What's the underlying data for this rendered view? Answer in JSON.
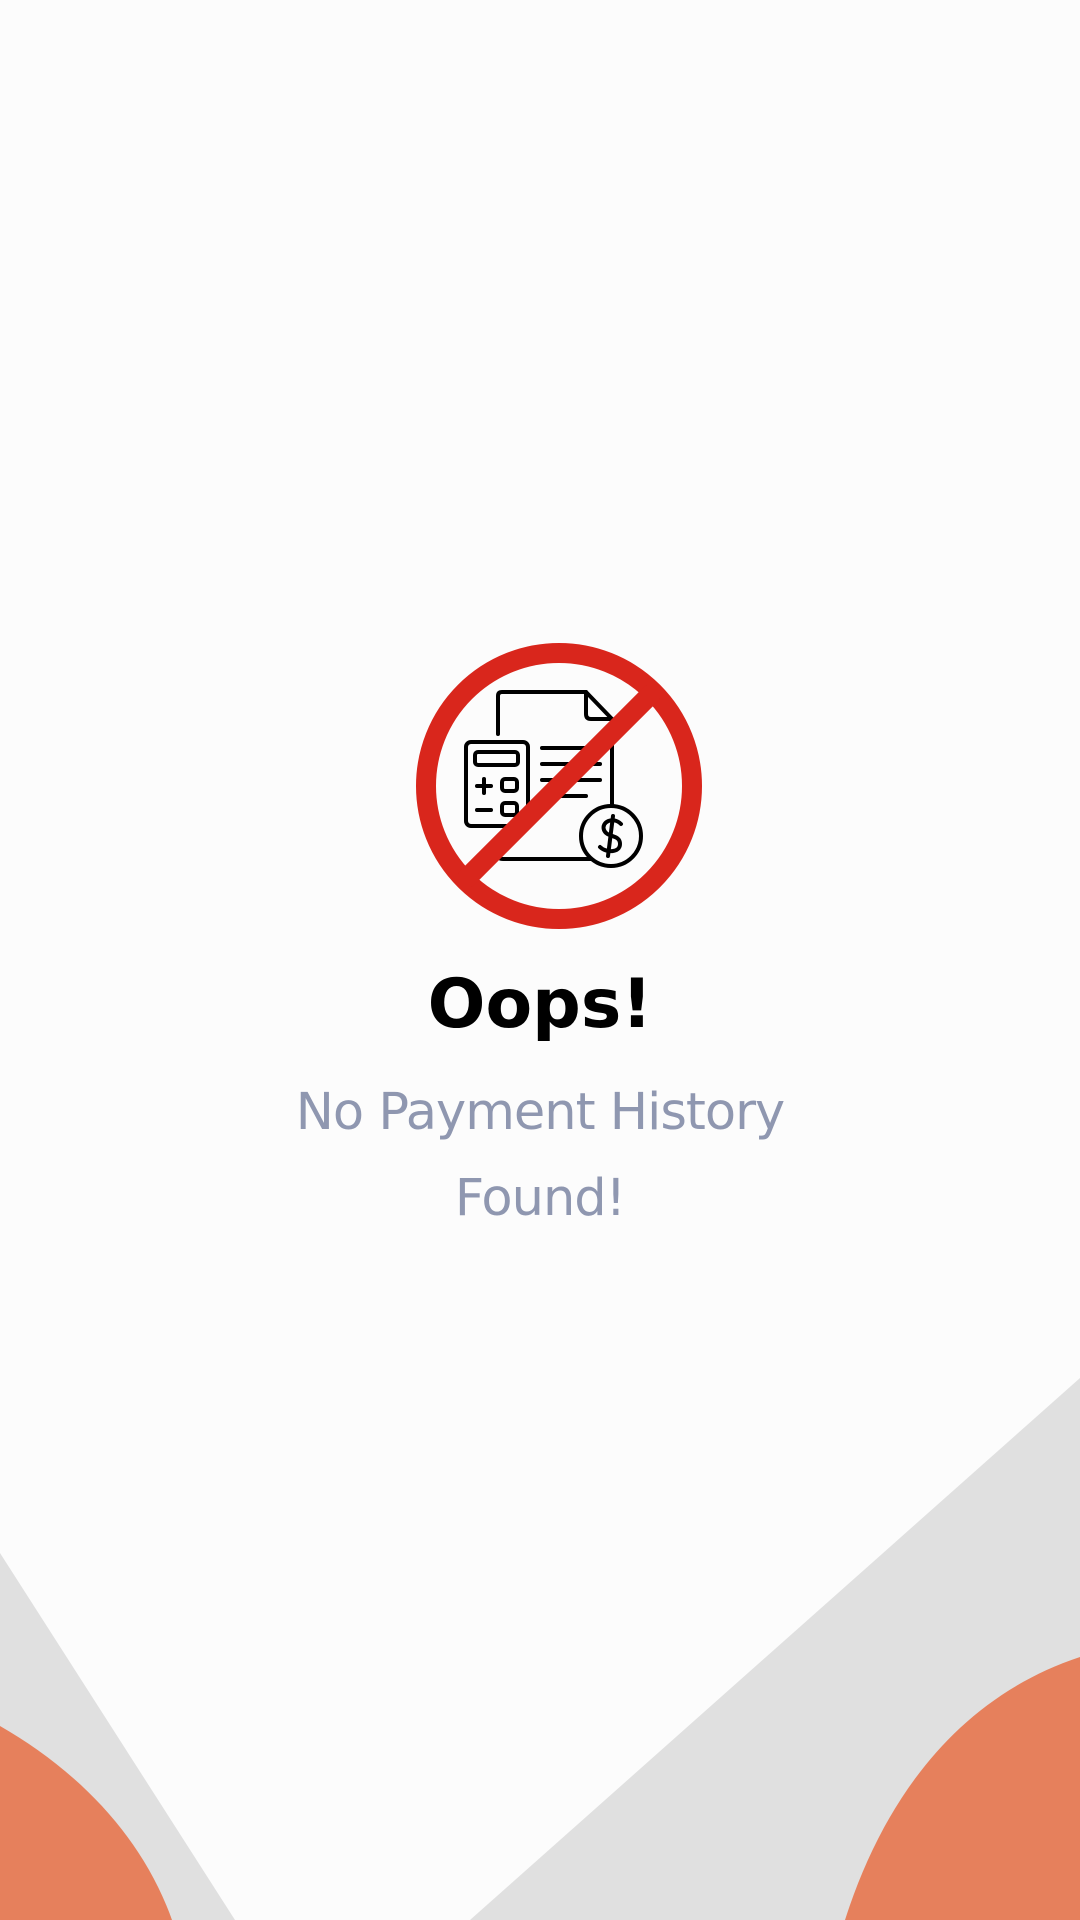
{
  "empty_state": {
    "icon": "no-payment-document-icon",
    "title": "Oops!",
    "message": "No Payment History Found!"
  },
  "colors": {
    "background": "#fcfcfc",
    "prohibit_red": "#d9261c",
    "message_gray": "#8f97b0",
    "decor_gray": "#e0e0e0",
    "decor_orange": "#e6805c"
  }
}
